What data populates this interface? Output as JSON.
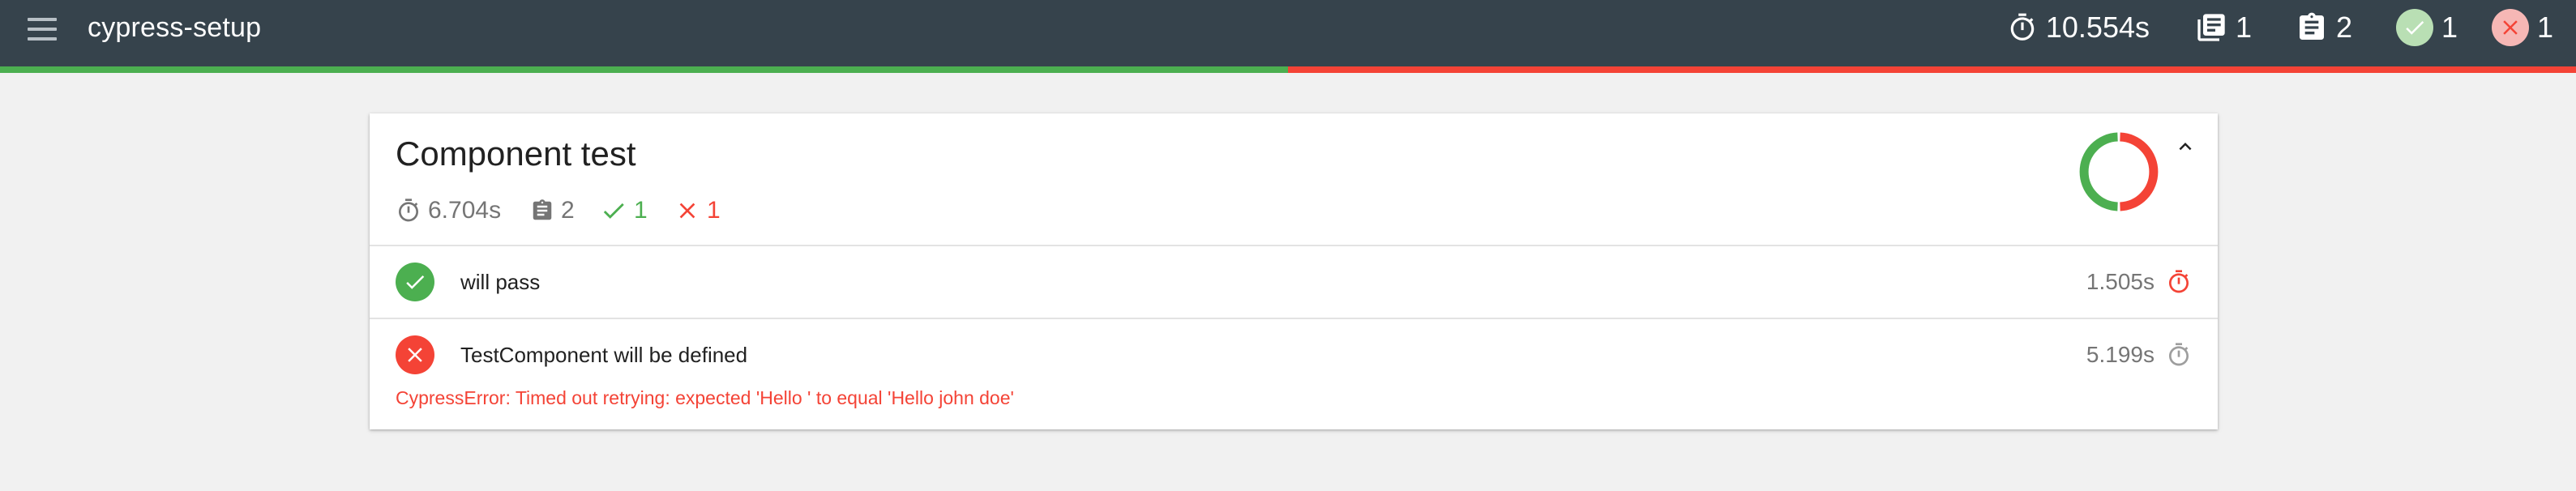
{
  "app": {
    "title": "cypress-setup"
  },
  "header_stats": {
    "duration": "10.554s",
    "suites": "1",
    "tests": "2",
    "passed": "1",
    "failed": "1",
    "icons": [
      "timer-icon",
      "suites-icon",
      "tests-clipboard-icon",
      "passed-check-icon",
      "failed-x-icon"
    ]
  },
  "progress": {
    "passed_fraction": 0.5,
    "failed_fraction": 0.5
  },
  "suite": {
    "title": "Component test",
    "duration": "6.704s",
    "tests": "2",
    "passed": "1",
    "failed": "1",
    "chart": {
      "passed": 1,
      "failed": 1
    }
  },
  "tests": [
    {
      "name": "will pass",
      "status": "passed",
      "duration": "1.505s",
      "duration_icon_color": "#f44336"
    },
    {
      "name": "TestComponent will be defined",
      "status": "failed",
      "duration": "5.199s",
      "duration_icon_color": "#9e9e9e",
      "error": "CypressError: Timed out retrying: expected 'Hello ' to equal 'Hello john doe'"
    }
  ],
  "colors": {
    "topbar": "#36434c",
    "pass": "#4caf50",
    "fail": "#f44336",
    "muted": "#757575"
  }
}
